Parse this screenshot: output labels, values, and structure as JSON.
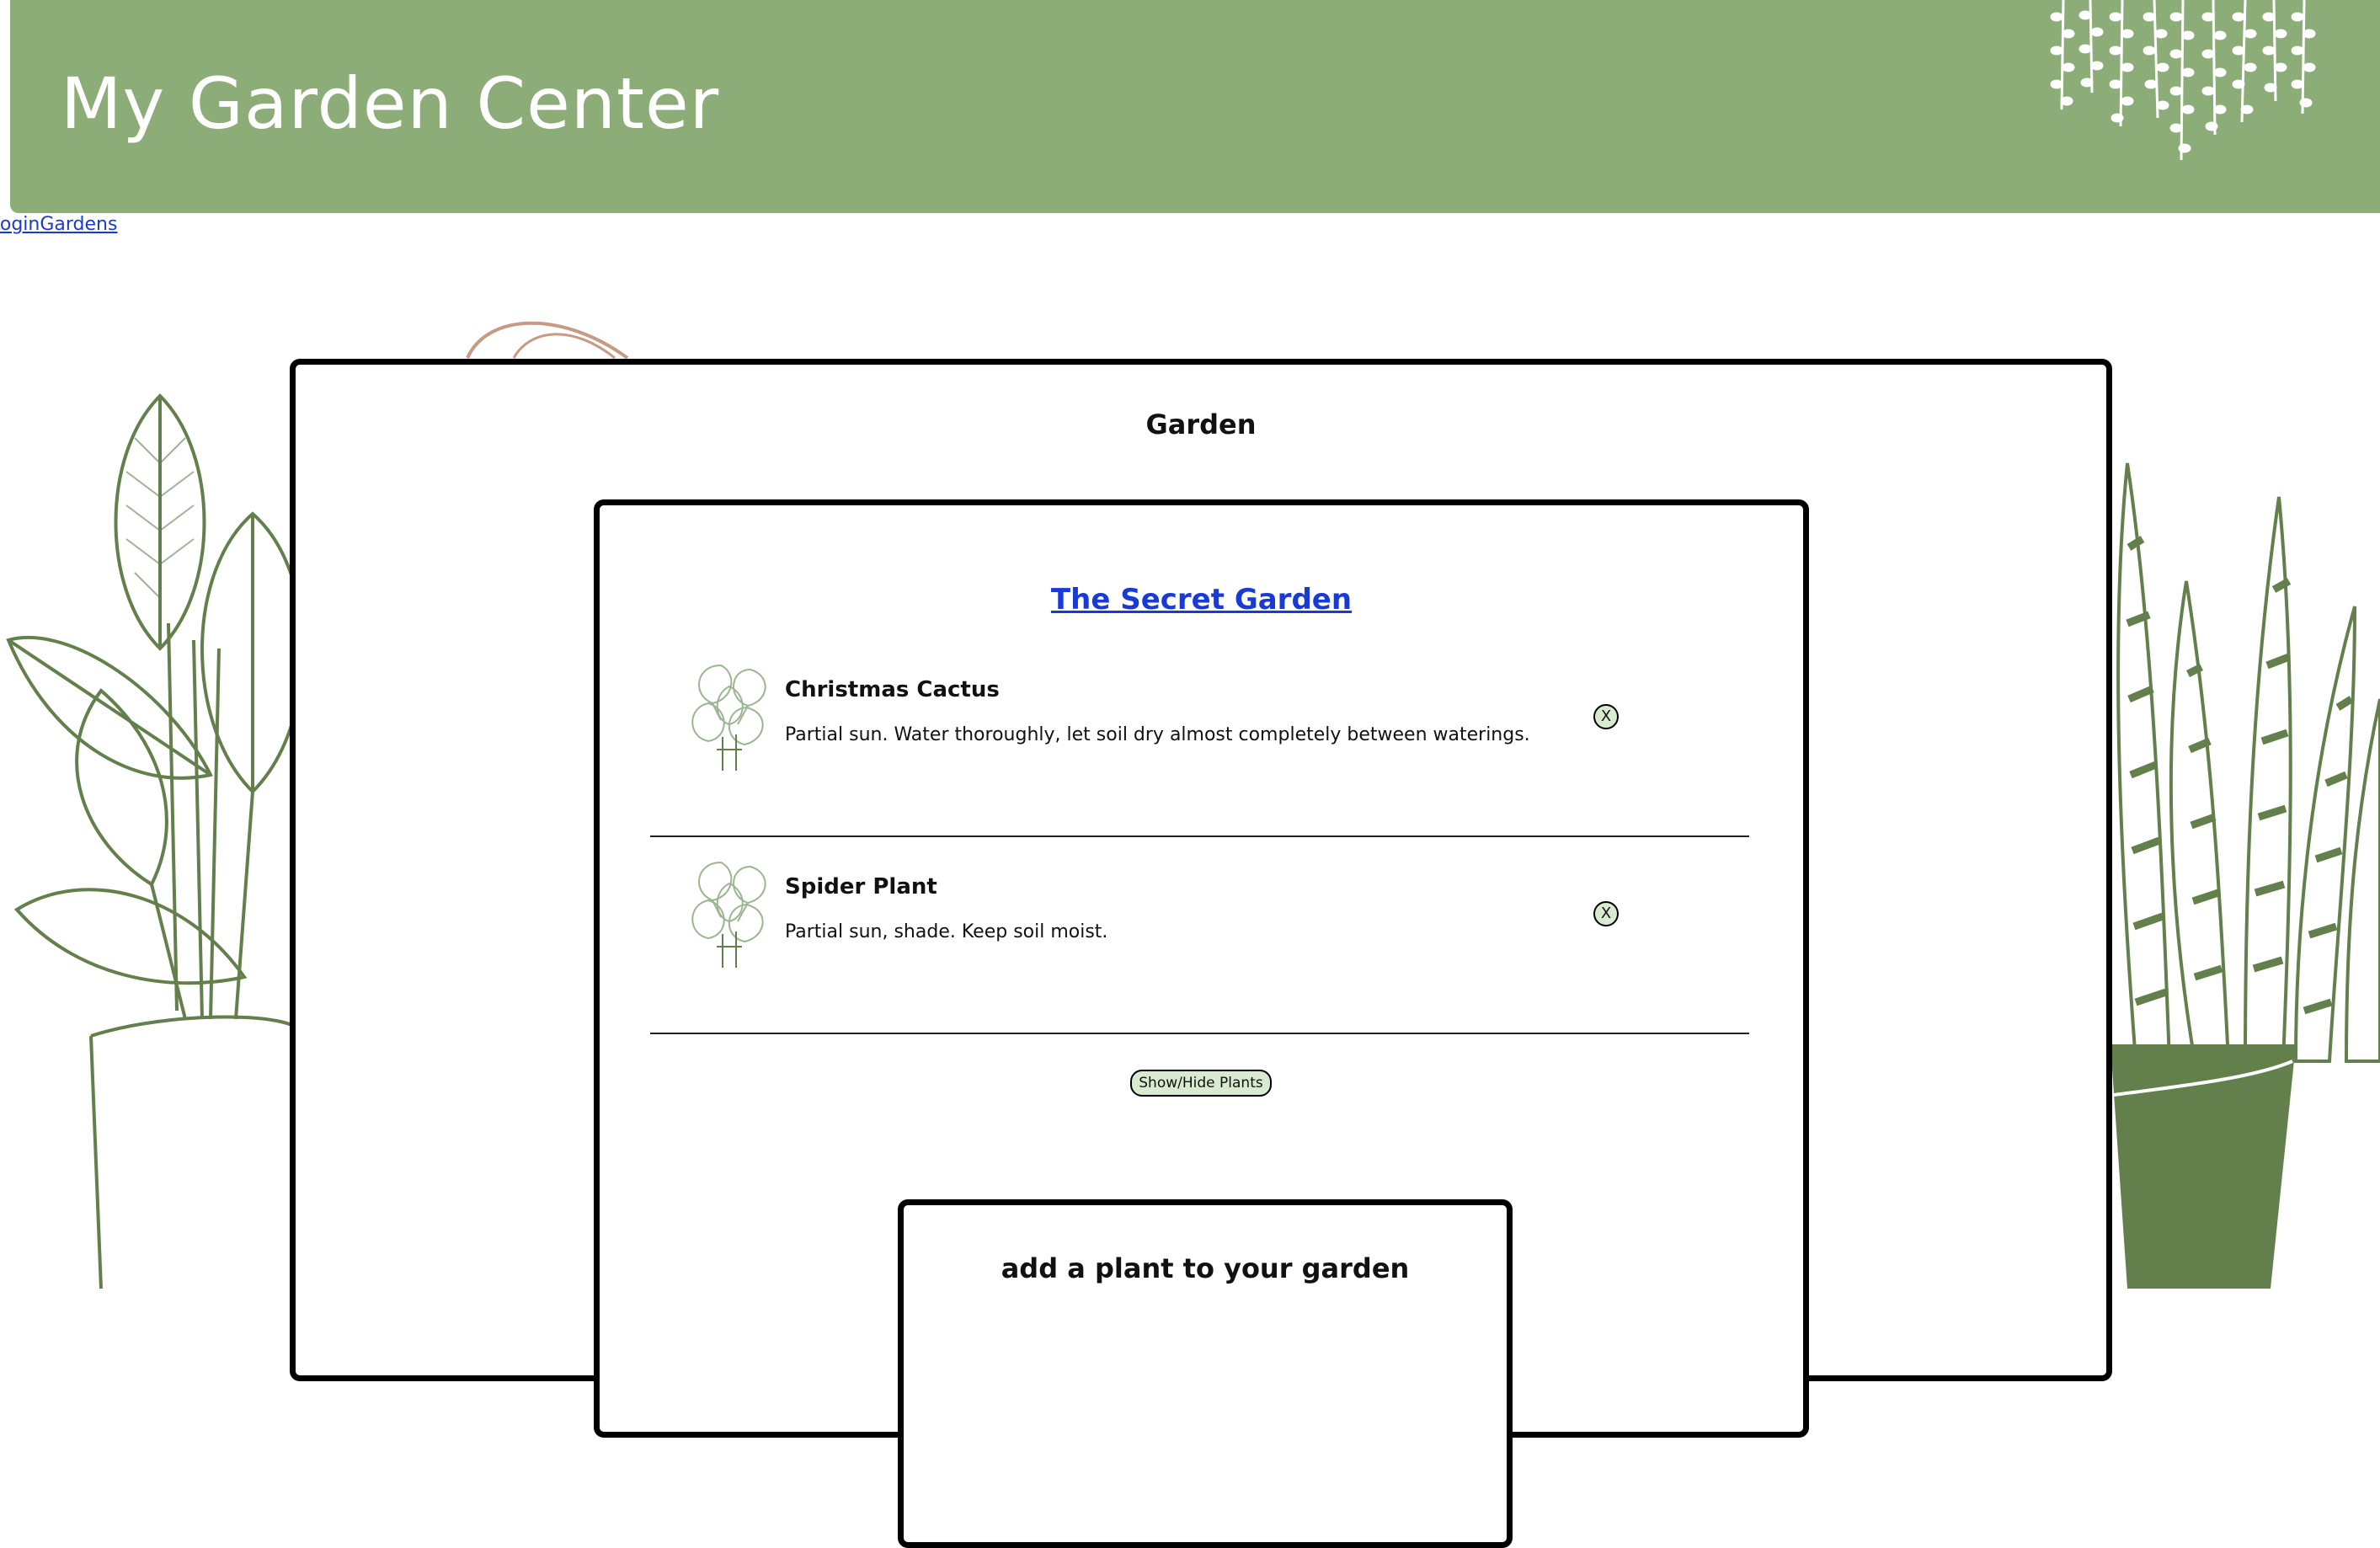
{
  "header": {
    "title": "My Garden Center"
  },
  "nav": {
    "links": [
      "Login",
      "Gardens"
    ]
  },
  "garden_section": {
    "title": "Garden",
    "garden": {
      "name": "The Secret Garden",
      "plants": [
        {
          "name": "Christmas Cactus",
          "care": "Partial sun. Water thoroughly, let soil dry almost completely between waterings.",
          "remove_label": "X"
        },
        {
          "name": "Spider Plant",
          "care": "Partial sun, shade. Keep soil moist.",
          "remove_label": "X"
        }
      ],
      "toggle_label": "Show/Hide Plants"
    },
    "add_plant": {
      "title": "add a plant to your garden"
    }
  },
  "colors": {
    "header_bg": "#8cad78",
    "plant_green": "#637f4b",
    "link_blue": "#1a3ad8",
    "button_bg": "#d8ead0"
  }
}
